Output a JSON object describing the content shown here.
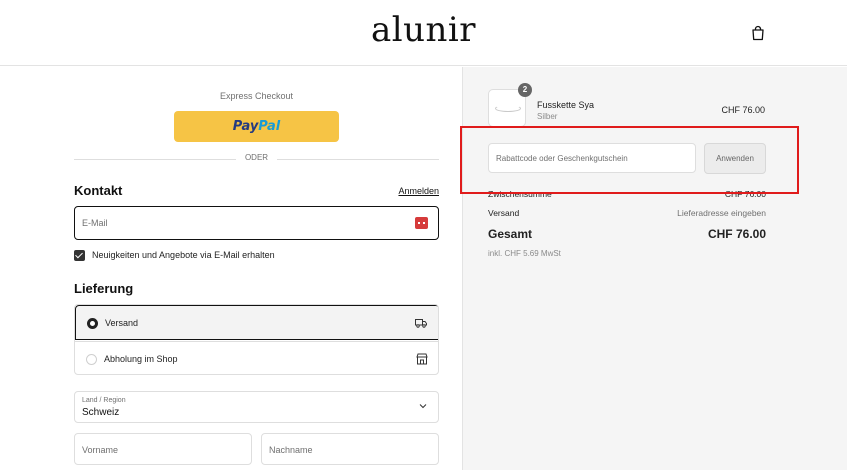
{
  "header": {
    "logo_text": "alunir",
    "cart_icon": "shopping-bag-icon"
  },
  "express": {
    "label": "Express Checkout",
    "paypal_pay": "Pay",
    "paypal_pal": "Pal",
    "divider_text": "ODER"
  },
  "contact": {
    "title": "Kontakt",
    "login_link": "Anmelden",
    "email_placeholder": "E-Mail",
    "newsletter_label": "Neuigkeiten und Angebote via E-Mail erhalten",
    "newsletter_checked": true
  },
  "delivery": {
    "title": "Lieferung",
    "options": [
      {
        "label": "Versand",
        "selected": true,
        "icon": "truck-icon"
      },
      {
        "label": "Abholung im Shop",
        "selected": false,
        "icon": "store-icon"
      }
    ],
    "country_label": "Land / Region",
    "country_value": "Schweiz",
    "first_name_placeholder": "Vorname",
    "last_name_placeholder": "Nachname"
  },
  "summary": {
    "product": {
      "name": "Fusskette Sya",
      "variant": "Silber",
      "price": "CHF 76.00",
      "quantity": "2"
    },
    "discount_placeholder": "Rabattcode oder Geschenkgutschein",
    "apply_label": "Anwenden",
    "subtotal_label": "Zwischensumme",
    "subtotal_value": "CHF 76.00",
    "shipping_label": "Versand",
    "shipping_value": "Lieferadresse eingeben",
    "total_label": "Gesamt",
    "total_value": "CHF 76.00",
    "tax_note": "inkl. CHF 5.69 MwSt"
  },
  "colors": {
    "paypal_yellow": "#f6c445",
    "highlight_red": "#e01b1b",
    "summary_bg": "#f5f5f5"
  }
}
